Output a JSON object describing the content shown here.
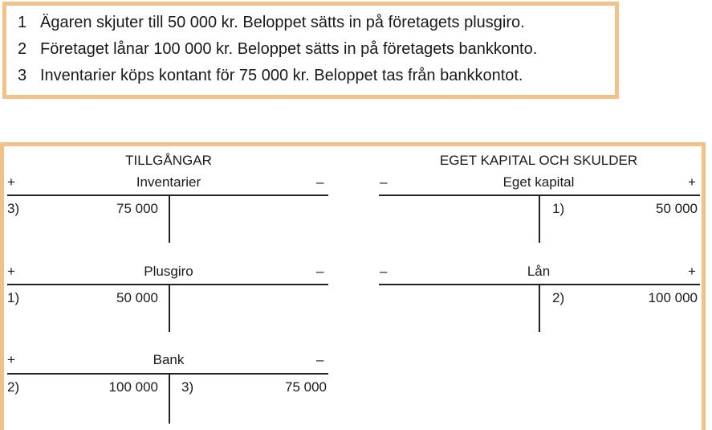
{
  "statements": [
    {
      "num": "1",
      "text": "Ägaren skjuter till 50 000 kr. Beloppet sätts in på företagets plusgiro."
    },
    {
      "num": "2",
      "text": "Företaget lånar 100 000 kr. Beloppet sätts in på företagets bankkonto."
    },
    {
      "num": "3",
      "text": "Inventarier köps kontant för 75 000 kr. Beloppet tas från bankkontot."
    }
  ],
  "assets": {
    "heading": "TILLGÅNGAR",
    "accounts": [
      {
        "name": "Inventarier",
        "left_sign": "+",
        "right_sign": "–",
        "left_ref": "3)",
        "left_amount": "75 000",
        "right_ref": "",
        "right_amount": ""
      },
      {
        "name": "Plusgiro",
        "left_sign": "+",
        "right_sign": "–",
        "left_ref": "1)",
        "left_amount": "50 000",
        "right_ref": "",
        "right_amount": ""
      },
      {
        "name": "Bank",
        "left_sign": "+",
        "right_sign": "–",
        "left_ref": "2)",
        "left_amount": "100 000",
        "right_ref": "3)",
        "right_amount": "75 000"
      }
    ]
  },
  "equity_liabilities": {
    "heading": "EGET KAPITAL OCH SKULDER",
    "accounts": [
      {
        "name": "Eget kapital",
        "left_sign": "–",
        "right_sign": "+",
        "left_ref": "",
        "left_amount": "",
        "right_ref": "1)",
        "right_amount": "50 000"
      },
      {
        "name": "Lån",
        "left_sign": "–",
        "right_sign": "+",
        "left_ref": "",
        "left_amount": "",
        "right_ref": "2)",
        "right_amount": "100 000"
      }
    ]
  },
  "colors": {
    "box_border": "#f0c189",
    "text": "#1a1a1a"
  }
}
